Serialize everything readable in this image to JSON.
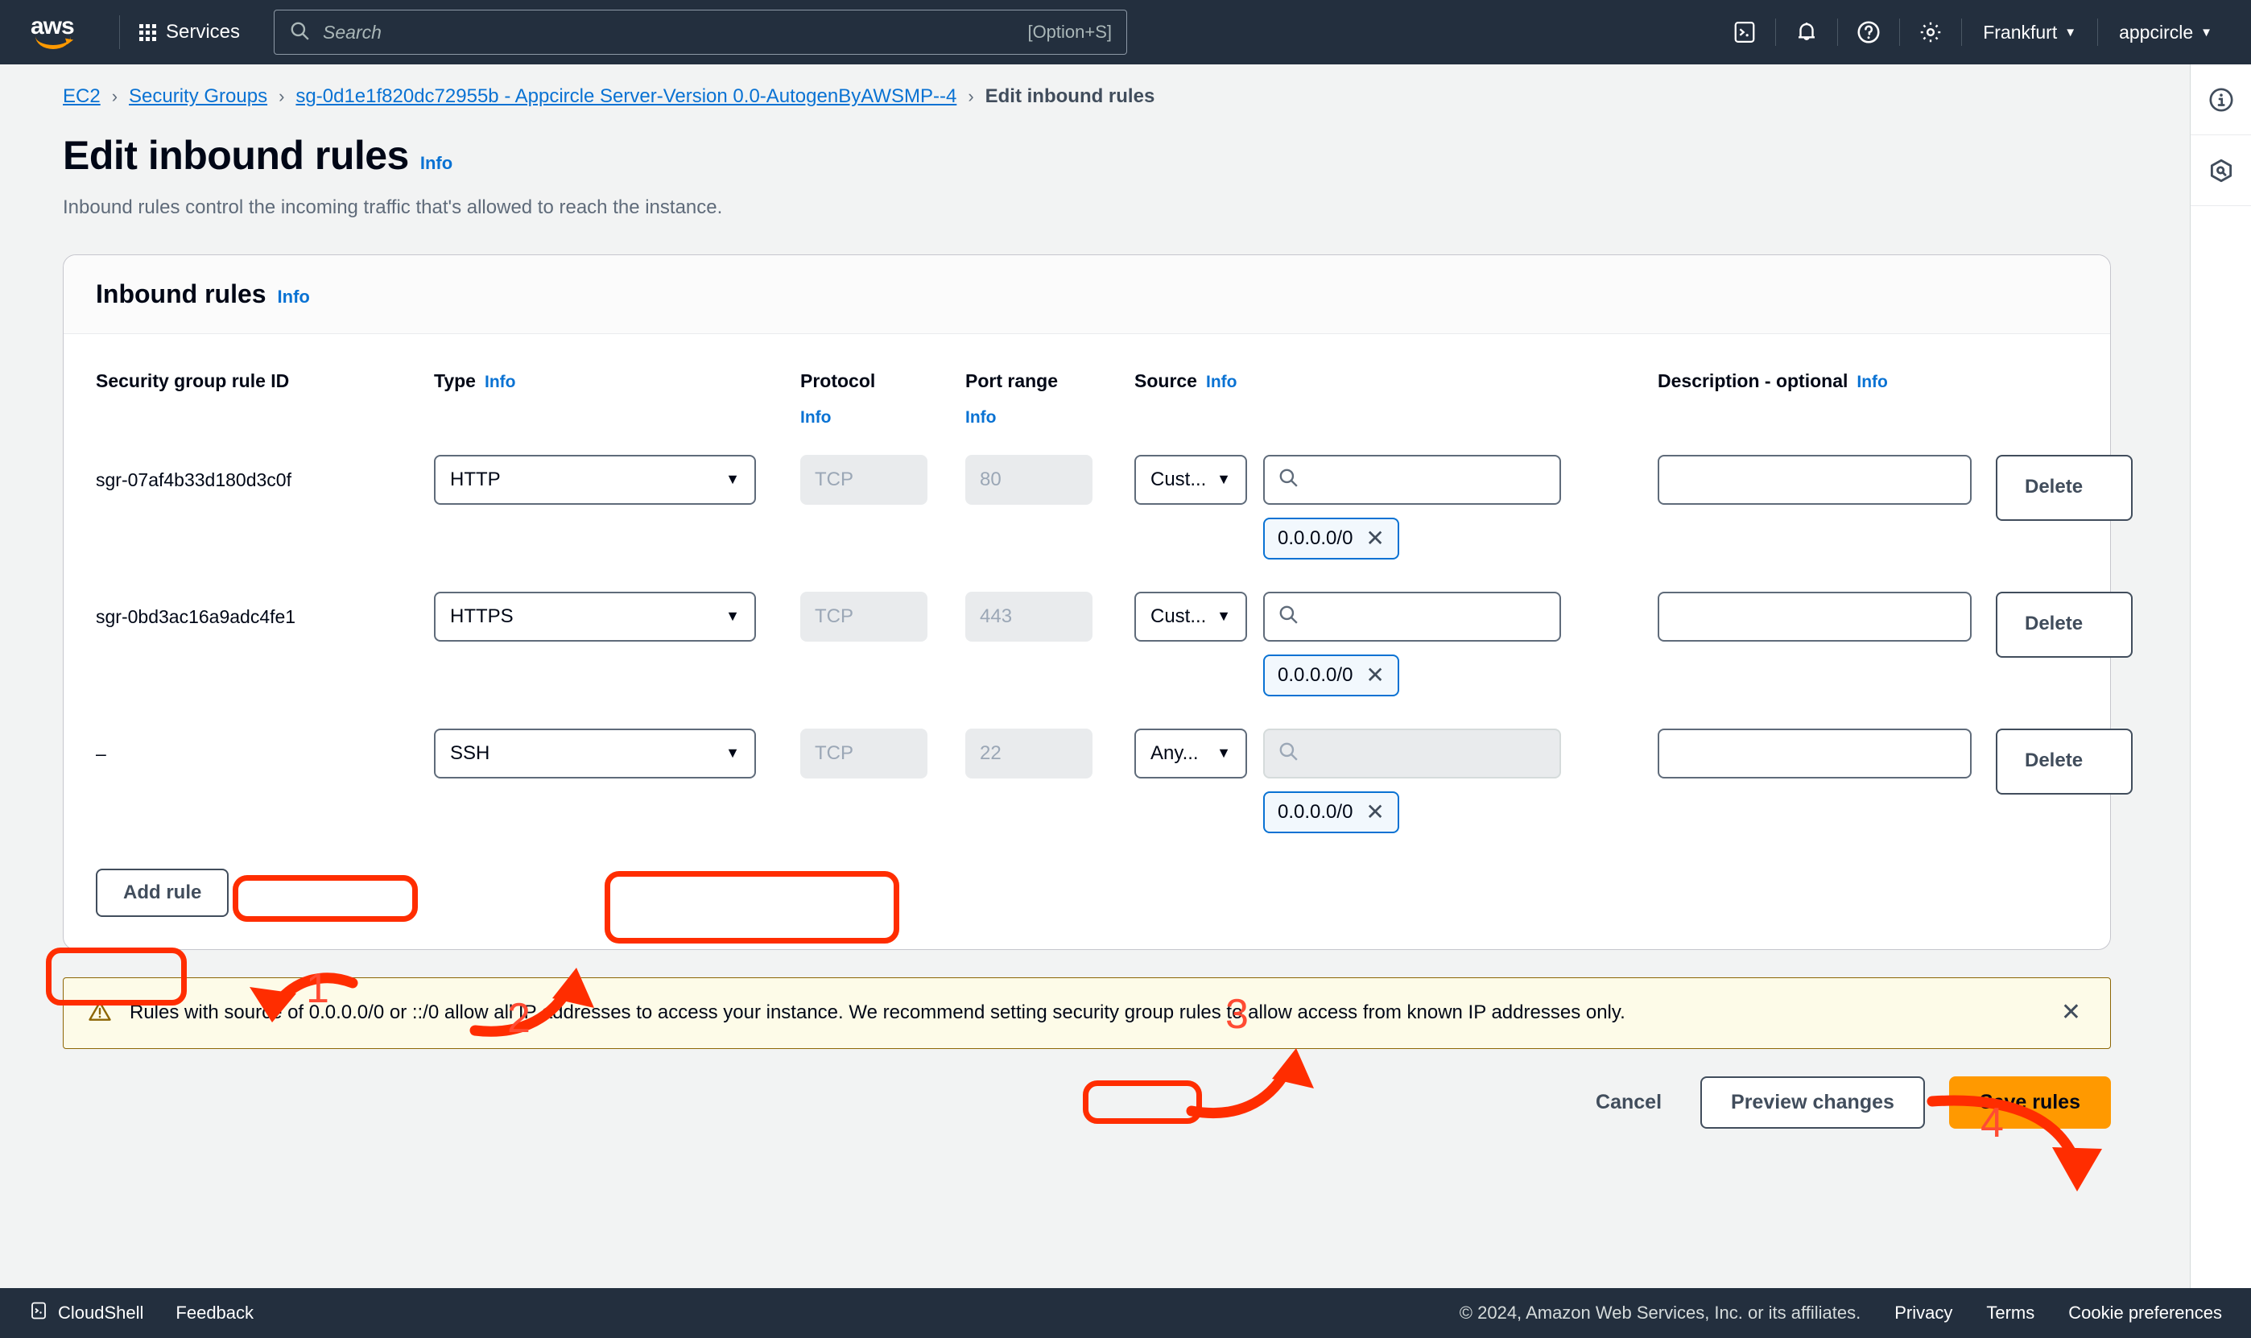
{
  "topnav": {
    "logo_text": "aws",
    "services_label": "Services",
    "search": {
      "placeholder": "Search",
      "value": "",
      "shortcut": "[Option+S]"
    },
    "icons": [
      "cloudshell-icon",
      "bell-icon",
      "help-icon",
      "settings-icon"
    ],
    "region": "Frankfurt",
    "account": "appcircle"
  },
  "breadcrumb": {
    "items": [
      {
        "label": "EC2",
        "type": "link"
      },
      {
        "label": "Security Groups",
        "type": "link"
      },
      {
        "label": "sg-0d1e1f820dc72955b - Appcircle Server-Version 0.0-AutogenByAWSMP--4",
        "type": "link"
      },
      {
        "label": "Edit inbound rules",
        "type": "current"
      }
    ],
    "separator": "›"
  },
  "page": {
    "title": "Edit inbound rules",
    "title_info": "Info",
    "subtitle": "Inbound rules control the incoming traffic that's allowed to reach the instance."
  },
  "card": {
    "title": "Inbound rules",
    "title_info": "Info",
    "headers": {
      "rule_id": "Security group rule ID",
      "type": "Type",
      "type_info": "Info",
      "protocol": "Protocol",
      "protocol_info": "Info",
      "port_range": "Port range",
      "port_range_info": "Info",
      "source": "Source",
      "source_info": "Info",
      "description": "Description - optional",
      "description_info": "Info",
      "delete": ""
    },
    "rows": [
      {
        "rule_id": "sgr-07af4b33d180d3c0f",
        "type": "HTTP",
        "protocol": "TCP",
        "port_range": "80",
        "source_type": "Cust...",
        "source_search_value": "",
        "source_search_disabled": false,
        "source_token": "0.0.0.0/0",
        "description": "",
        "delete_label": "Delete"
      },
      {
        "rule_id": "sgr-0bd3ac16a9adc4fe1",
        "type": "HTTPS",
        "protocol": "TCP",
        "port_range": "443",
        "source_type": "Cust...",
        "source_search_value": "",
        "source_search_disabled": false,
        "source_token": "0.0.0.0/0",
        "description": "",
        "delete_label": "Delete"
      },
      {
        "rule_id": "–",
        "type": "SSH",
        "protocol": "TCP",
        "port_range": "22",
        "source_type": "Any...",
        "source_search_value": "",
        "source_search_disabled": true,
        "source_token": "0.0.0.0/0",
        "description": "",
        "delete_label": "Delete"
      }
    ],
    "add_rule_label": "Add rule"
  },
  "alert": {
    "icon": "warning-icon",
    "text": "Rules with source of 0.0.0.0/0 or ::/0 allow all IP addresses to access your instance. We recommend setting security group rules to allow access from known IP addresses only.",
    "dismiss": "✕"
  },
  "actions": {
    "cancel": "Cancel",
    "preview": "Preview changes",
    "save": "Save rules"
  },
  "right_rail": {
    "items": [
      {
        "name": "info-panel-icon"
      },
      {
        "name": "amazon-q-icon"
      }
    ]
  },
  "footer": {
    "cloudshell": "CloudShell",
    "feedback": "Feedback",
    "copyright": "© 2024, Amazon Web Services, Inc. or its affiliates.",
    "privacy": "Privacy",
    "terms": "Terms",
    "cookies": "Cookie preferences"
  },
  "annotations": {
    "color": "#ff2d00",
    "steps": [
      {
        "num": "1",
        "target": "add-rule-button"
      },
      {
        "num": "2",
        "target": "row-3-type-select"
      },
      {
        "num": "3",
        "target": "row-3-source-cell"
      },
      {
        "num": "4",
        "target": "save-rules-button"
      }
    ]
  }
}
